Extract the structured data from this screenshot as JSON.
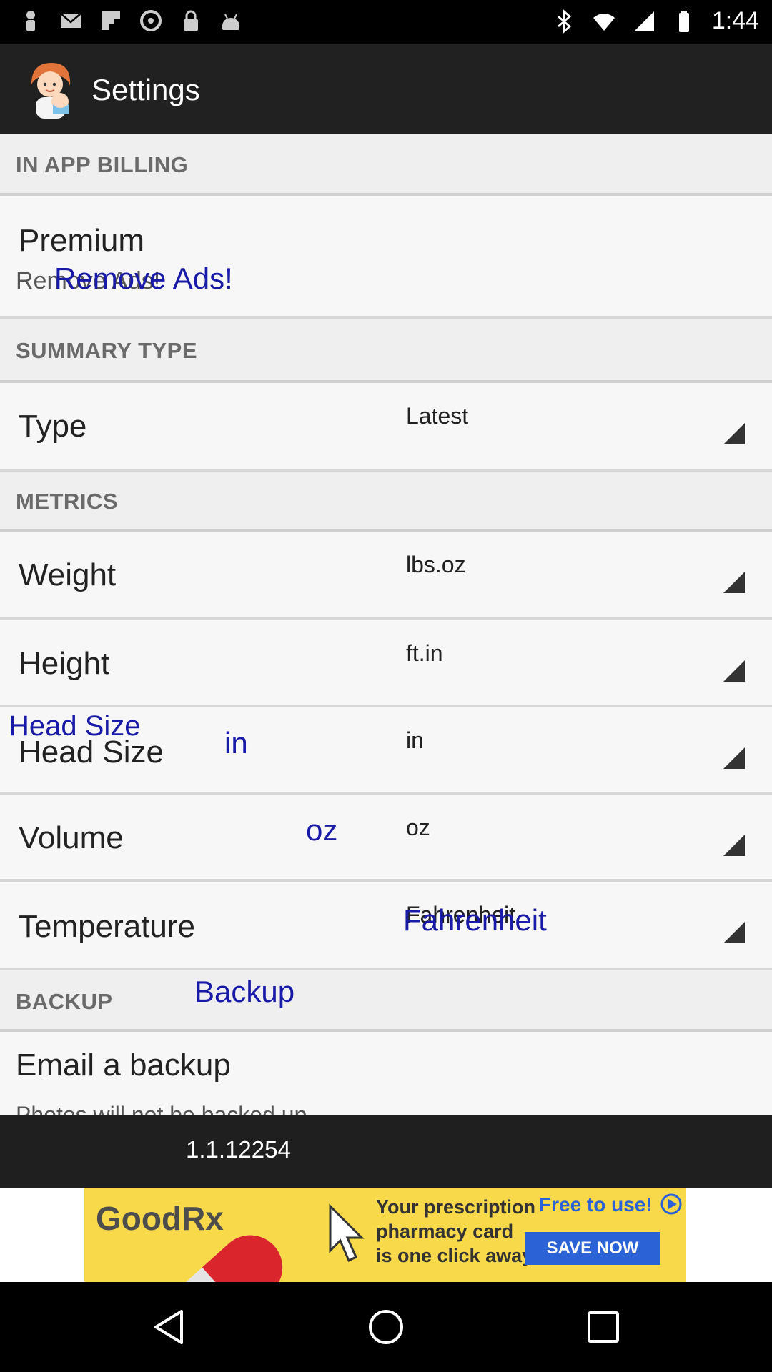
{
  "status_bar": {
    "time": "1:44",
    "left_icons": [
      "person-icon",
      "mail-icon",
      "flipboard-icon",
      "settings-icon",
      "lock-icon",
      "android-icon"
    ],
    "right_icons": [
      "bluetooth-icon",
      "wifi-icon",
      "signal-icon",
      "battery-icon"
    ]
  },
  "action_bar": {
    "title": "Settings",
    "icon": "baby-app-icon"
  },
  "sections": {
    "billing": {
      "header": "IN APP BILLING",
      "premium_title": "Premium",
      "premium_summary": "Remove Ads!",
      "premium_overlay": "Remove Ads!"
    },
    "summary": {
      "header": "SUMMARY TYPE",
      "type_title": "Type",
      "type_value": "Latest"
    },
    "metrics": {
      "header": "METRICS",
      "weight_title": "Weight",
      "weight_value": "lbs.oz",
      "height_title": "Height",
      "height_value": "ft.in",
      "head_title": "Head Size",
      "head_value": "in",
      "head_overlay_title": "Head Size",
      "head_overlay_value": "in",
      "volume_title": "Volume",
      "volume_value": "oz",
      "volume_overlay_value": "oz",
      "temp_title": "Temperature",
      "temp_value": "Fahrenheit",
      "temp_overlay_value": "Fahrenheit"
    },
    "backup": {
      "header": "BACKUP",
      "header_overlay": "Backup",
      "email_title": "Email a backup",
      "email_summary": "Photos will not be backed up"
    }
  },
  "version": "1.1.12254",
  "ad": {
    "brand": "GoodRx",
    "line1": "Your prescription",
    "line2": "pharmacy card",
    "line3": "is one click away.",
    "free_text": "Free to use!",
    "button": "SAVE NOW"
  },
  "nav": {
    "back": "back-icon",
    "home": "home-icon",
    "recents": "recents-icon"
  }
}
